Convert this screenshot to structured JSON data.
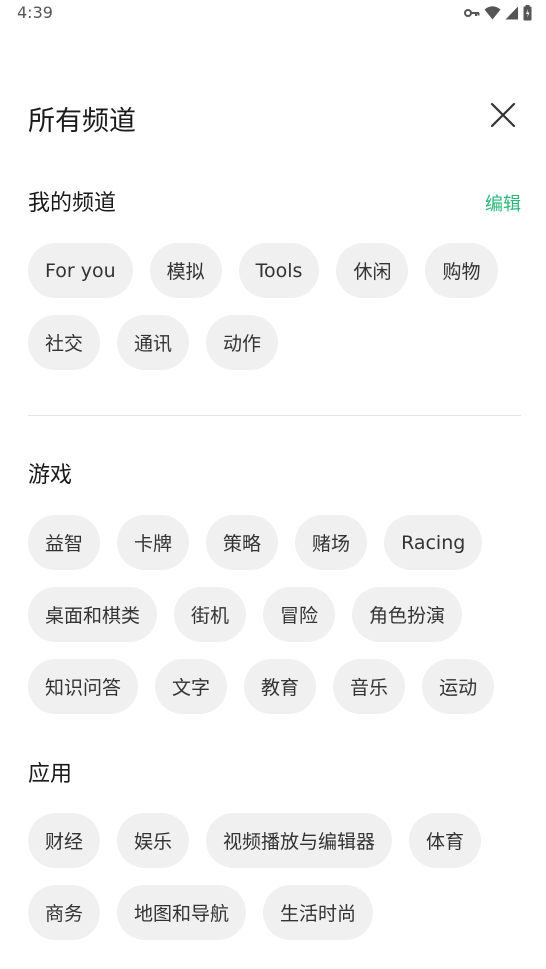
{
  "status_bar": {
    "time": "4:39",
    "icons": [
      "vpn-key-icon",
      "wifi-icon",
      "signal-icon",
      "battery-icon"
    ]
  },
  "header": {
    "title": "所有频道",
    "close_icon": "close-icon"
  },
  "my_channels": {
    "title": "我的频道",
    "edit_label": "编辑",
    "accent_color": "#29b878",
    "rows": [
      [
        "For you",
        "模拟",
        "Tools",
        "休闲",
        "购物"
      ],
      [
        "社交",
        "通讯",
        "动作"
      ]
    ]
  },
  "games": {
    "title": "游戏",
    "rows": [
      [
        "益智",
        "卡牌",
        "策略",
        "赌场",
        "Racing"
      ],
      [
        "桌面和棋类",
        "街机",
        "冒险",
        "角色扮演"
      ],
      [
        "知识问答",
        "文字",
        "教育",
        "音乐",
        "运动"
      ]
    ]
  },
  "apps": {
    "title": "应用",
    "rows": [
      [
        "财经",
        "娱乐",
        "视频播放与编辑器",
        "体育"
      ],
      [
        "商务",
        "地图和导航",
        "生活时尚"
      ]
    ]
  }
}
